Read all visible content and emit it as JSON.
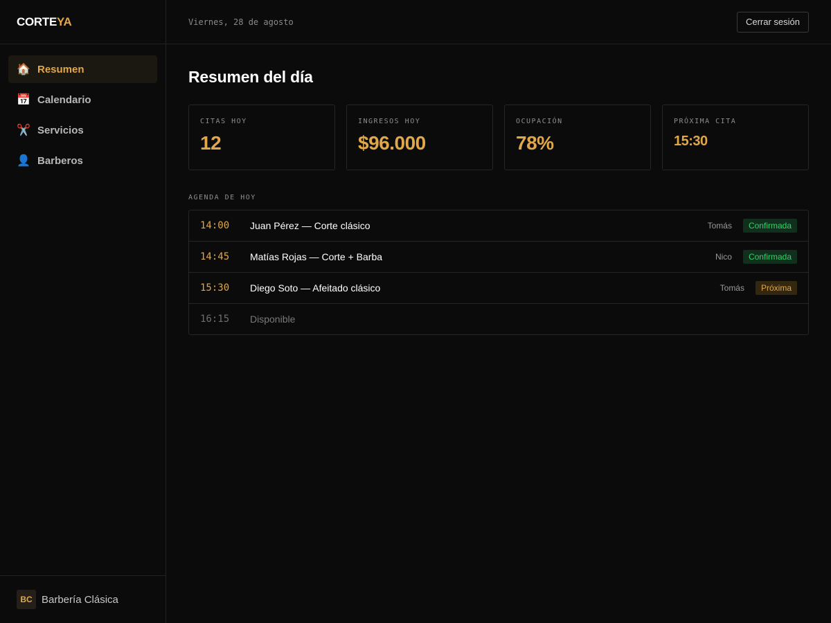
{
  "brand": {
    "part1": "CORTE",
    "part2": "YA"
  },
  "sidebar": {
    "items": [
      {
        "icon": "🏠",
        "icon_name": "house-icon",
        "label": "Resumen",
        "active": true
      },
      {
        "icon": "📅",
        "icon_name": "calendar-icon",
        "label": "Calendario",
        "active": false
      },
      {
        "icon": "✂️",
        "icon_name": "scissors-icon",
        "label": "Servicios",
        "active": false
      },
      {
        "icon": "👤",
        "icon_name": "person-icon",
        "label": "Barberos",
        "active": false
      }
    ],
    "footer": {
      "avatar": "BC",
      "name": "Barbería Clásica"
    }
  },
  "header": {
    "date": "Viernes, 28 de agosto",
    "logout_label": "Cerrar sesión"
  },
  "main": {
    "title": "Resumen del día",
    "stats": [
      {
        "label": "CITAS HOY",
        "value": "12"
      },
      {
        "label": "INGRESOS HOY",
        "value": "$96.000"
      },
      {
        "label": "OCUPACIÓN",
        "value": "78%"
      },
      {
        "label": "PRÓXIMA CITA",
        "value": "15:30"
      }
    ],
    "agenda_label": "AGENDA DE HOY",
    "agenda": [
      {
        "time": "14:00",
        "desc": "Juan Pérez — Corte clásico",
        "barber": "Tomás",
        "status": "Confirmada"
      },
      {
        "time": "14:45",
        "desc": "Matías Rojas — Corte + Barba",
        "barber": "Nico",
        "status": "Confirmada"
      },
      {
        "time": "15:30",
        "desc": "Diego Soto — Afeitado clásico",
        "barber": "Tomás",
        "status": "Próxima"
      },
      {
        "time": "16:15",
        "desc": "Disponible",
        "barber": "",
        "status": ""
      }
    ]
  },
  "colors": {
    "accent": "#e0a84a",
    "background": "#0b0b0b",
    "confirmed": "#35d26b",
    "border": "#262626"
  }
}
